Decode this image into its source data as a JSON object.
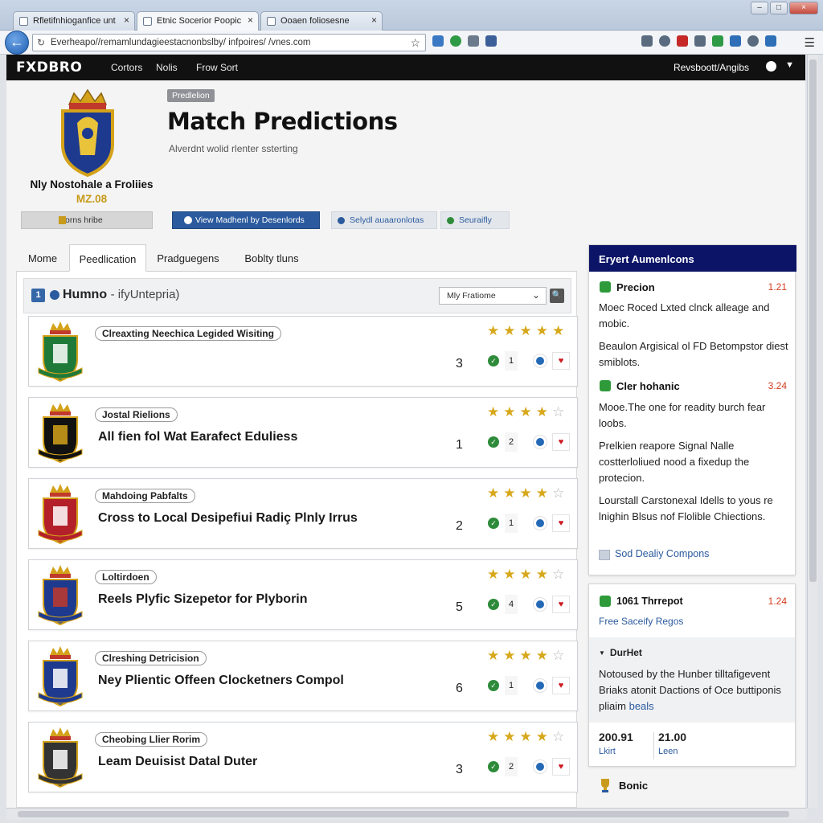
{
  "browser": {
    "tabs": [
      {
        "label": "Rfletifnhioganfice unt"
      },
      {
        "label": "Etnic Socerior Poopic"
      },
      {
        "label": "Ooaen foliosesne"
      }
    ],
    "url": "Everheapo//remamlundagieestacnonbslby/ infpoires/ /vnes.com"
  },
  "site": {
    "logo": "FXDBRO",
    "nav": [
      "Cortors",
      "Nolis",
      "Frow Sort"
    ],
    "user_label": "Revsboott/Angibs"
  },
  "hero": {
    "badge": "Predlelion",
    "title": "Match Predictions",
    "subtitle": "Alverdnt wolid rlenter ssterting",
    "club_name": "Nly Nostohale a Froliies",
    "club_year": "MZ.08"
  },
  "actions": {
    "team_button": "Yorns hribe",
    "view_button": "View Madhenl by Desenlords",
    "chip1": "Selydl auaaronlotas",
    "chip2": "Seuraifly"
  },
  "tabs": [
    "Mome",
    "Peedlication",
    "Pradguegens",
    "Boblty tluns"
  ],
  "list": {
    "number": "1",
    "title": "Humno",
    "title_suffix": "- ifyUntepria)",
    "filter": "Mly Fratiome"
  },
  "matches": [
    {
      "tag": "Clreaxting Neechica Legided Wisiting",
      "title": "",
      "num": "3",
      "count": "1",
      "rating": 5
    },
    {
      "tag": "Jostal Rielions",
      "title": "All fien fol Wat Earafect Eduliess",
      "num": "1",
      "count": "2",
      "rating": 4
    },
    {
      "tag": "Mahdoing Pabfalts",
      "title": "Cross to Local Desipefiui Radiç Plnly Irrus",
      "num": "2",
      "count": "1",
      "rating": 4
    },
    {
      "tag": "Loltirdoen",
      "title": "Reels Plyfic Sizepetor for Plyborin",
      "num": "5",
      "count": "4",
      "rating": 4
    },
    {
      "tag": "Clreshing Detricision",
      "title": "Ney Plientic Offeen Clocketners Compol",
      "num": "6",
      "count": "1",
      "rating": 4
    },
    {
      "tag": "Cheobing Llier Rorim",
      "title": "Leam Deuisist Datal Duter",
      "num": "3",
      "count": "2",
      "rating": 4
    }
  ],
  "expert": {
    "heading": "Eryert Aumenlcons",
    "item1_label": "Precion",
    "item1_value": "1.21",
    "p1": "Moec Roced Lxted clnck alleage and mobic.",
    "p2": "Beaulon Argisical ol FD Betompstor diest smiblots.",
    "item2_label": "Cler hohanic",
    "item2_value": "3.24",
    "p3": "Mooe.The one for readity burch fear loobs.",
    "p4": "Prelkien reapore Signal Nalle costterloliued nood a fixedup the protecion.",
    "p5": "Lourstall Carstonexal Idells to yous re lnighin Blsus nof Flolible Chiections.",
    "link": "Sod Dealiy Compons"
  },
  "threat": {
    "label": "1061 Thrrepot",
    "value": "1.24",
    "link": "Free Saceify Regos",
    "sub_heading": "DurHet",
    "text": "Notoused by the Hunber tilltafigevent Briaks atonit Dactions of Oce buttiponis pliaim",
    "text_link": "beals",
    "stat1": "200.91",
    "stat1_label": "Lkirt",
    "stat2": "21.00",
    "stat2_label": "Leen"
  },
  "bonus": {
    "label": "Bonic"
  }
}
